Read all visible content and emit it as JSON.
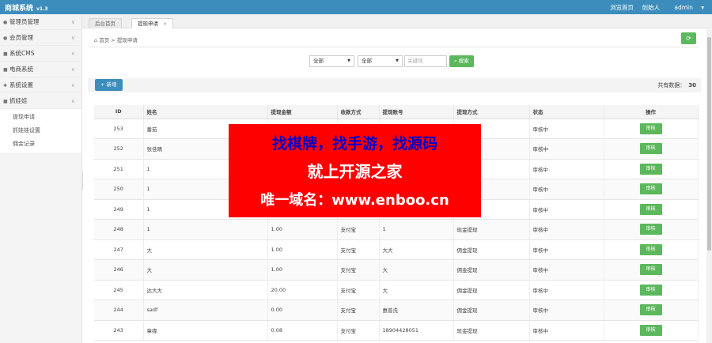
{
  "app": {
    "title": "商城系统",
    "version": "v1.3"
  },
  "topnav": {
    "browse": "浏览首页",
    "user": "创始人",
    "admin": "admin",
    "caret": "▾"
  },
  "sidebar": {
    "items": [
      {
        "label": "管理员管理",
        "icon": "user-icon",
        "glyph": "●",
        "chev": "∨"
      },
      {
        "label": "会员管理",
        "icon": "users-icon",
        "glyph": "●",
        "chev": "∨"
      },
      {
        "label": "系统CMS",
        "icon": "file-icon",
        "glyph": "■",
        "chev": "∨"
      },
      {
        "label": "电商系统",
        "icon": "cart-icon",
        "glyph": "■",
        "chev": "∨"
      },
      {
        "label": "系统设置",
        "icon": "gear-icon",
        "glyph": "✱",
        "chev": "∨"
      },
      {
        "label": "抓娃娃",
        "icon": "folder-icon",
        "glyph": "■",
        "chev": "∧"
      }
    ],
    "subitems": [
      "提现申请",
      "抓娃娃设置",
      "佣金记录"
    ],
    "collapse_glyph": "‹"
  },
  "tabs": [
    {
      "label": "后台首页"
    },
    {
      "label": "提现申请",
      "close": "×"
    }
  ],
  "breadcrumb": {
    "home_icon": "⌂",
    "home": "首页",
    "sep": ">",
    "current": "提现申请"
  },
  "refresh_glyph": "⟳",
  "search": {
    "select1": "全部",
    "select2": "全部",
    "caret": "▼",
    "keyword_placeholder": "关键词",
    "button": "搜索",
    "button_glyph": "⌕"
  },
  "toolbar": {
    "add_label": "+ 新增",
    "total_label": "共有数据：",
    "total": "30"
  },
  "table": {
    "headers": [
      "ID",
      "姓名",
      "提现金额",
      "收款方式",
      "提现账号",
      "提现方式",
      "状态",
      "操作"
    ],
    "action_label": "审核",
    "rows": [
      {
        "id": "253",
        "name": "番茄",
        "amount": "",
        "method": "",
        "account": "",
        "type": "",
        "status": "审核中"
      },
      {
        "id": "252",
        "name": "张佳晴",
        "amount": "",
        "method": "",
        "account": "",
        "type": "",
        "status": "审核中"
      },
      {
        "id": "251",
        "name": "1",
        "amount": "",
        "method": "",
        "account": "",
        "type": "",
        "status": "审核中"
      },
      {
        "id": "250",
        "name": "1",
        "amount": "",
        "method": "",
        "account": "",
        "type": "",
        "status": "审核中"
      },
      {
        "id": "249",
        "name": "1",
        "amount": "",
        "method": "",
        "account": "",
        "type": "",
        "status": "审核中"
      },
      {
        "id": "248",
        "name": "1",
        "amount": "1.00",
        "method": "支付宝",
        "account": "1",
        "type": "现金提现",
        "status": "审核中"
      },
      {
        "id": "247",
        "name": "大",
        "amount": "1.00",
        "method": "支付宝",
        "account": "大大",
        "type": "佣金提现",
        "status": "审核中"
      },
      {
        "id": "246",
        "name": "大",
        "amount": "1.00",
        "method": "支付宝",
        "account": "大",
        "type": "佣金提现",
        "status": "审核中"
      },
      {
        "id": "245",
        "name": "达大大",
        "amount": "20.00",
        "method": "支付宝",
        "account": "大",
        "type": "佣金提现",
        "status": "审核中"
      },
      {
        "id": "244",
        "name": "sadf",
        "amount": "0.00",
        "method": "支付宝",
        "account": "惠普洗",
        "type": "佣金提现",
        "status": "审核中"
      },
      {
        "id": "243",
        "name": "章缘",
        "amount": "0.08",
        "method": "支付宝",
        "account": "18904428051",
        "type": "现金提现",
        "status": "审核中"
      }
    ]
  },
  "watermark": {
    "line1": "找棋牌，找手游，找源码",
    "line2": "就上开源之家",
    "line3": "唯一域名：www.enboo.cn"
  }
}
